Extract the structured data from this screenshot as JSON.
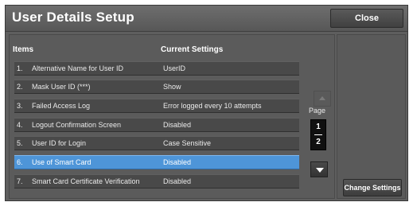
{
  "header": {
    "title": "User Details Setup",
    "close_label": "Close"
  },
  "table": {
    "col_items": "Items",
    "col_settings": "Current Settings",
    "rows": [
      {
        "num": "1.",
        "item": "Alternative Name for User ID",
        "setting": "UserID",
        "selected": false
      },
      {
        "num": "2.",
        "item": "Mask User ID (***)",
        "setting": "Show",
        "selected": false
      },
      {
        "num": "3.",
        "item": "Failed Access Log",
        "setting": "Error logged every 10 attempts",
        "selected": false
      },
      {
        "num": "4.",
        "item": "Logout Confirmation Screen",
        "setting": "Disabled",
        "selected": false
      },
      {
        "num": "5.",
        "item": "User ID for Login",
        "setting": "Case Sensitive",
        "selected": false
      },
      {
        "num": "6.",
        "item": "Use of Smart Card",
        "setting": "Disabled",
        "selected": true
      },
      {
        "num": "7.",
        "item": "Smart Card Certificate Verification",
        "setting": "Disabled",
        "selected": false
      }
    ]
  },
  "pager": {
    "label": "Page",
    "current": "1",
    "total": "2"
  },
  "actions": {
    "change_settings_label": "Change Settings"
  },
  "colors": {
    "selected_row": "#4e95d8",
    "background": "#5e5e5e"
  }
}
